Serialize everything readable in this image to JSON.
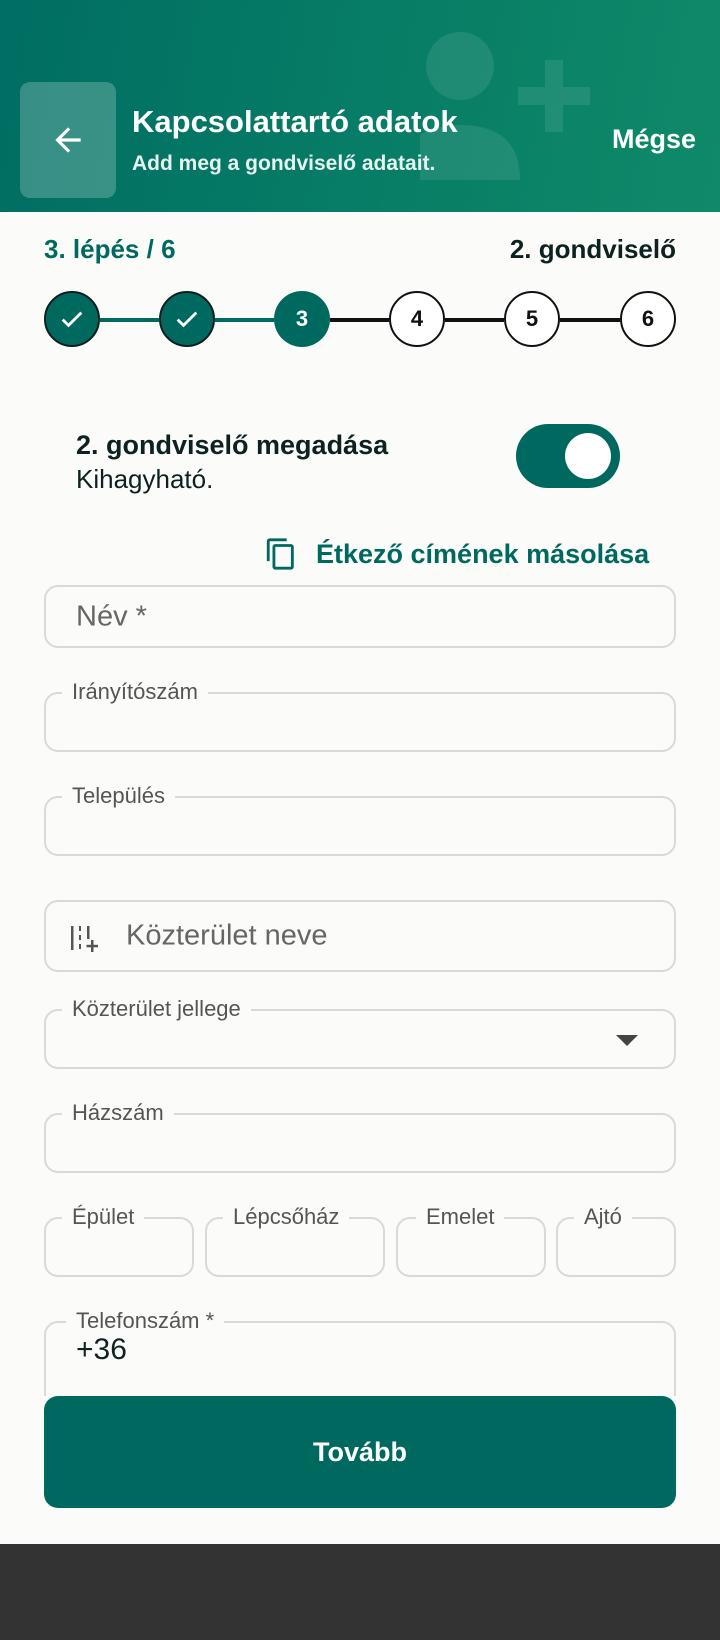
{
  "header": {
    "title": "Kapcsolattartó adatok",
    "subtitle": "Add meg a gondviselő adatait.",
    "cancel_label": "Mégse",
    "colors": {
      "primary": "#00695f",
      "gradient_end": "#0e8a68"
    }
  },
  "progress": {
    "step_text": "3. lépés / 6",
    "guardian_text": "2. gondviselő",
    "steps": [
      {
        "label": "",
        "state": "done"
      },
      {
        "label": "",
        "state": "done"
      },
      {
        "label": "3",
        "state": "active"
      },
      {
        "label": "4",
        "state": "todo"
      },
      {
        "label": "5",
        "state": "todo"
      },
      {
        "label": "6",
        "state": "todo"
      }
    ],
    "current_step": 3,
    "total_steps": 6
  },
  "toggle": {
    "title": "2. gondviselő megadása",
    "subtitle": "Kihagyható.",
    "on": true
  },
  "copy_action": {
    "label": "Étkező címének másolása",
    "icon": "copy-icon"
  },
  "form": {
    "name": {
      "placeholder": "Név *"
    },
    "zip": {
      "label": "Irányítószám",
      "value": ""
    },
    "city": {
      "label": "Település",
      "value": ""
    },
    "street": {
      "placeholder": "Közterület neve",
      "icon": "street-icon"
    },
    "street_type": {
      "label": "Közterület jellege",
      "value": ""
    },
    "house_number": {
      "label": "Házszám",
      "value": ""
    },
    "building": {
      "label": "Épület",
      "value": ""
    },
    "staircase": {
      "label": "Lépcsőház",
      "value": ""
    },
    "floor": {
      "label": "Emelet",
      "value": ""
    },
    "door": {
      "label": "Ajtó",
      "value": ""
    },
    "phone": {
      "label": "Telefonszám *",
      "value": "+36"
    }
  },
  "next_button": {
    "label": "Tovább"
  }
}
